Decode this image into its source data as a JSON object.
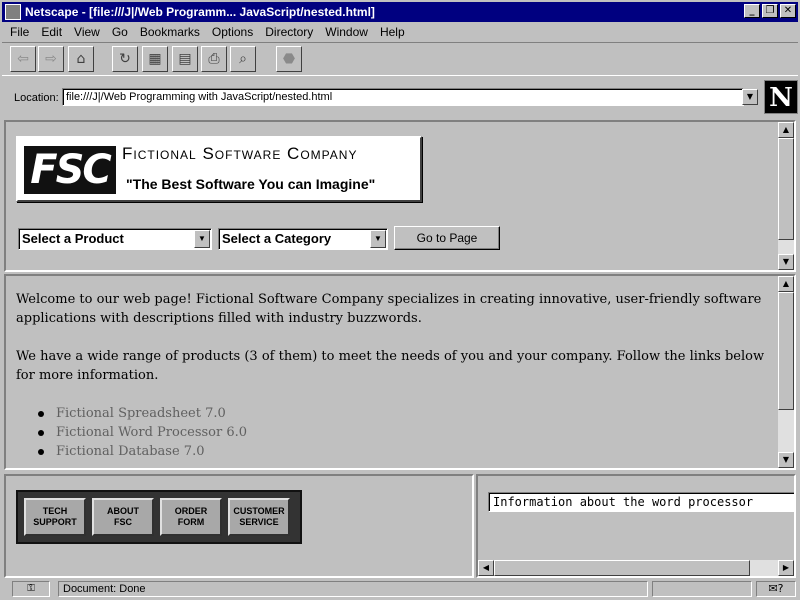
{
  "window": {
    "title": "Netscape - [file:///J|/Web Programm... JavaScript/nested.html]",
    "controls": {
      "minimize": "_",
      "maximize": "❐",
      "close": "✕"
    }
  },
  "menu": [
    "File",
    "Edit",
    "View",
    "Go",
    "Bookmarks",
    "Options",
    "Directory",
    "Window",
    "Help"
  ],
  "toolbar": {
    "icons": [
      "back-icon",
      "forward-icon",
      "home-icon",
      "reload-icon",
      "images-icon",
      "open-icon",
      "print-icon",
      "find-icon",
      "stop-icon"
    ],
    "glyphs": {
      "back": "⇦",
      "forward": "⇨",
      "home": "⌂",
      "reload": "↻",
      "images": "▦",
      "open": "▤",
      "print": "⎙",
      "find": "⌕",
      "stop": "⬣"
    }
  },
  "location": {
    "label": "Location:",
    "url": "file:///J|/Web Programming with JavaScript/nested.html",
    "logo": "N"
  },
  "banner": {
    "mark": "FSC",
    "company": "Fictional Software Company",
    "slogan": "\"The Best Software You can Imagine\""
  },
  "form": {
    "product_select": "Select a Product",
    "category_select": "Select a Category",
    "go_button": "Go to Page"
  },
  "main": {
    "paragraph1": "Welcome to our web page! Fictional Software Company specializes in creating innovative, user-friendly software applications with descriptions filled with industry buzzwords.",
    "paragraph2": "We have a wide range of products (3 of them) to meet the needs of you and your company. Follow the links below for more information.",
    "links": [
      "Fictional Spreadsheet 7.0",
      "Fictional Word Processor 6.0",
      "Fictional Database 7.0"
    ]
  },
  "navbar": {
    "buttons": [
      "TECH\nSUPPORT",
      "ABOUT\nFSC",
      "ORDER\nFORM",
      "CUSTOMER\nSERVICE"
    ]
  },
  "info": {
    "text": "Information about the word processor"
  },
  "status": {
    "text": "Document: Done",
    "security_icon": "⚿",
    "mail_icon": "✉?"
  },
  "scroll": {
    "up": "▲",
    "down": "▼",
    "left": "◀",
    "right": "▶",
    "dropdown": "▼"
  },
  "colors": {
    "titlebar": "#000080",
    "chrome": "#c0c0c0",
    "link_visited": "#606060"
  }
}
